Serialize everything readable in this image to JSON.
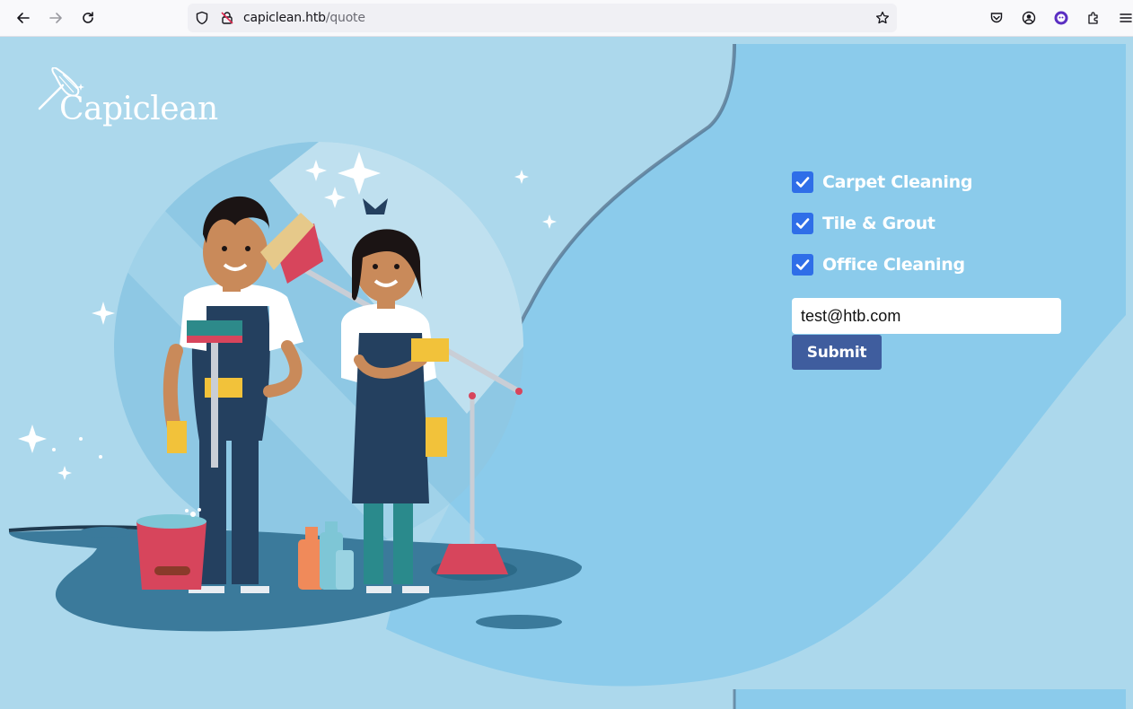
{
  "browser": {
    "url_host": "capiclean.htb",
    "url_path": "/quote"
  },
  "site": {
    "logo_text": "Capiclean"
  },
  "form": {
    "services": [
      {
        "label": "Carpet Cleaning",
        "checked": true
      },
      {
        "label": "Tile & Grout",
        "checked": true
      },
      {
        "label": "Office Cleaning",
        "checked": true
      }
    ],
    "email_value": "test@htb.com",
    "submit_label": "Submit"
  },
  "colors": {
    "page_bg": "#acd8ec",
    "panel_bg": "#8bcbeb",
    "checkbox": "#2f6ee8",
    "submit_bg": "#3f5d9e"
  }
}
